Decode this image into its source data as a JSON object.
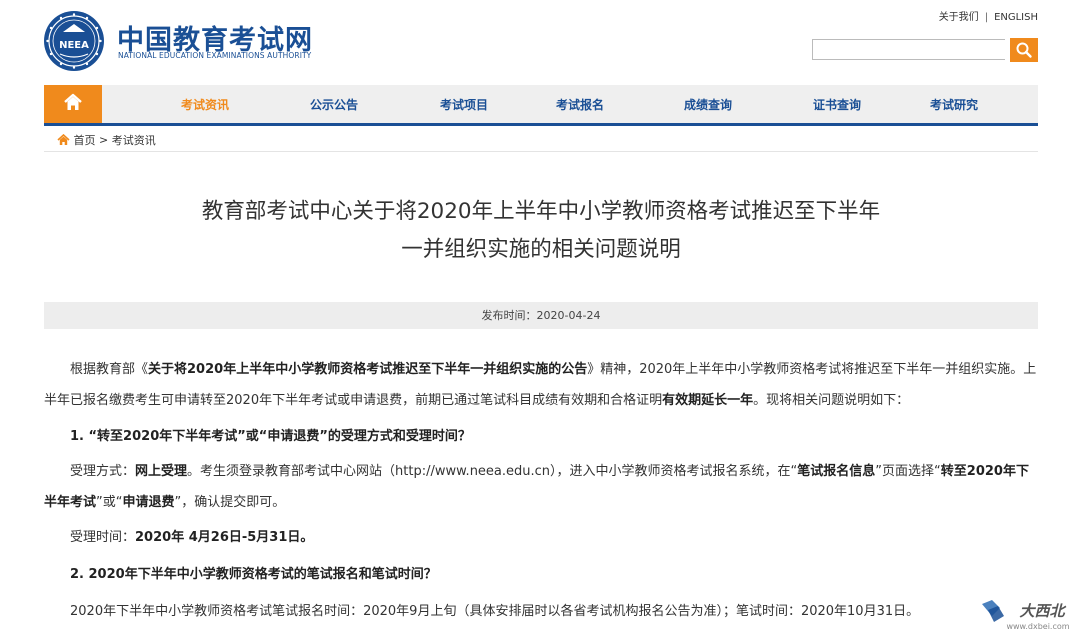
{
  "header": {
    "site_name": "中国教育考试网",
    "site_name_en": "NATIONAL EDUCATION EXAMINATIONS AUTHORITY",
    "logo_text": "NEEA",
    "top_links": [
      "关于我们",
      "ENGLISH"
    ],
    "search_placeholder": "",
    "accent": "#f08a1c",
    "brand": "#1a4f95"
  },
  "nav": {
    "home_icon": "home-icon",
    "items": [
      "考试资讯",
      "公示公告",
      "考试项目",
      "考试报名",
      "成绩查询",
      "证书查询",
      "考试研究"
    ],
    "active_index": 0
  },
  "breadcrumb": {
    "home": "首页",
    "separator": ">",
    "current": "考试资讯"
  },
  "article": {
    "title_line1": "教育部考试中心关于将2020年上半年中小学教师资格考试推迟至下半年",
    "title_line2": "一并组织实施的相关问题说明",
    "publish_label": "发布时间：",
    "publish_date": "2020-04-24",
    "p1": {
      "t1": "根据教育部《",
      "b1": "关于将2020年上半年中小学教师资格考试推迟至下半年一并组织实施的公告",
      "t2": "》精神，2020年上半年中小学教师资格考试将推迟至下半年一并组织实施。上半年已报名缴费考生可申请转至2020年下半年考试或申请退费，前期已通过笔试科目成绩有效期和合格证明",
      "b2": "有效期延长一年",
      "t3": "。现将相关问题说明如下："
    },
    "h1": "1. “转至2020年下半年考试”或“申请退费”的受理方式和受理时间？",
    "p2": {
      "t1": "受理方式：",
      "b1": "网上受理",
      "t2": "。考生须登录教育部考试中心网站（http://www.neea.edu.cn），进入中小学教师资格考试报名系统，在“",
      "b2": "笔试报名信息",
      "t3": "”页面选择“",
      "b3": "转至2020年下半年考试",
      "t4": "”或“",
      "b4": "申请退费",
      "t5": "”，确认提交即可。"
    },
    "p3": {
      "t1": "受理时间：",
      "b1": "2020年 4月26日-5月31日。"
    },
    "h2": "2. 2020年下半年中小学教师资格考试的笔试报名和笔试时间？",
    "p4": "2020年下半年中小学教师资格考试笔试报名时间：2020年9月上旬（具体安排届时以各省考试机构报名公告为准）；笔试时间：2020年10月31日。"
  },
  "watermark": {
    "text": "大西北",
    "url": "www.dxbei.com"
  }
}
